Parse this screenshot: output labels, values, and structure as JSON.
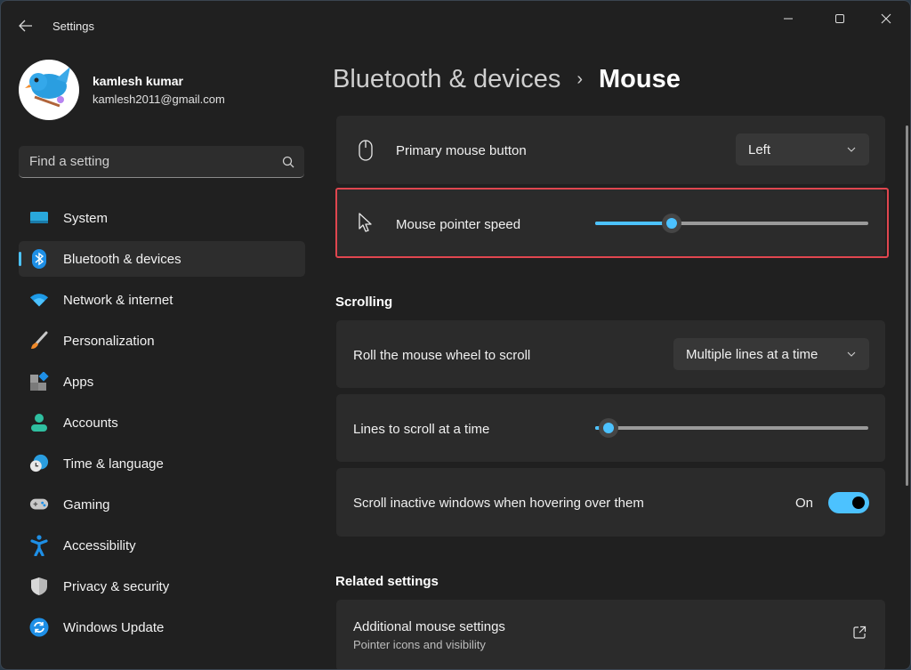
{
  "window": {
    "app_title": "Settings",
    "controls": {
      "minimize": "minimize-icon",
      "maximize": "maximize-icon",
      "close": "close-icon"
    }
  },
  "profile": {
    "name": "kamlesh kumar",
    "email": "kamlesh2011@gmail.com",
    "avatar": "bird-avatar"
  },
  "search": {
    "placeholder": "Find a setting",
    "value": "",
    "icon": "search-icon"
  },
  "sidebar": {
    "items": [
      {
        "label": "System",
        "icon": "system-icon",
        "active": false
      },
      {
        "label": "Bluetooth & devices",
        "icon": "bluetooth-icon",
        "active": true
      },
      {
        "label": "Network & internet",
        "icon": "wifi-icon",
        "active": false
      },
      {
        "label": "Personalization",
        "icon": "brush-icon",
        "active": false
      },
      {
        "label": "Apps",
        "icon": "apps-icon",
        "active": false
      },
      {
        "label": "Accounts",
        "icon": "accounts-icon",
        "active": false
      },
      {
        "label": "Time & language",
        "icon": "time-language-icon",
        "active": false
      },
      {
        "label": "Gaming",
        "icon": "gamepad-icon",
        "active": false
      },
      {
        "label": "Accessibility",
        "icon": "accessibility-icon",
        "active": false
      },
      {
        "label": "Privacy & security",
        "icon": "shield-icon",
        "active": false
      },
      {
        "label": "Windows Update",
        "icon": "update-icon",
        "active": false
      }
    ]
  },
  "header": {
    "parent": "Bluetooth & devices",
    "separator": "›",
    "current": "Mouse"
  },
  "mouse": {
    "primary_button": {
      "label": "Primary mouse button",
      "value": "Left",
      "icon": "mouse-icon"
    },
    "pointer_speed": {
      "label": "Mouse pointer speed",
      "value_fraction": 0.28,
      "icon": "pointer-icon",
      "highlighted": true
    }
  },
  "scrolling": {
    "title": "Scrolling",
    "roll_wheel": {
      "label": "Roll the mouse wheel to scroll",
      "value": "Multiple lines at a time"
    },
    "lines_to_scroll": {
      "label": "Lines to scroll at a time",
      "value_fraction": 0.05
    },
    "inactive_windows": {
      "label": "Scroll inactive windows when hovering over them",
      "state_label": "On",
      "on": true
    }
  },
  "related": {
    "title": "Related settings",
    "additional_mouse": {
      "label": "Additional mouse settings",
      "sublabel": "Pointer icons and visibility",
      "icon": "open-external-icon"
    }
  },
  "colors": {
    "accent": "#4cc2ff",
    "highlight_border": "#e0464f",
    "background": "#202020",
    "card": "#2b2b2b"
  }
}
